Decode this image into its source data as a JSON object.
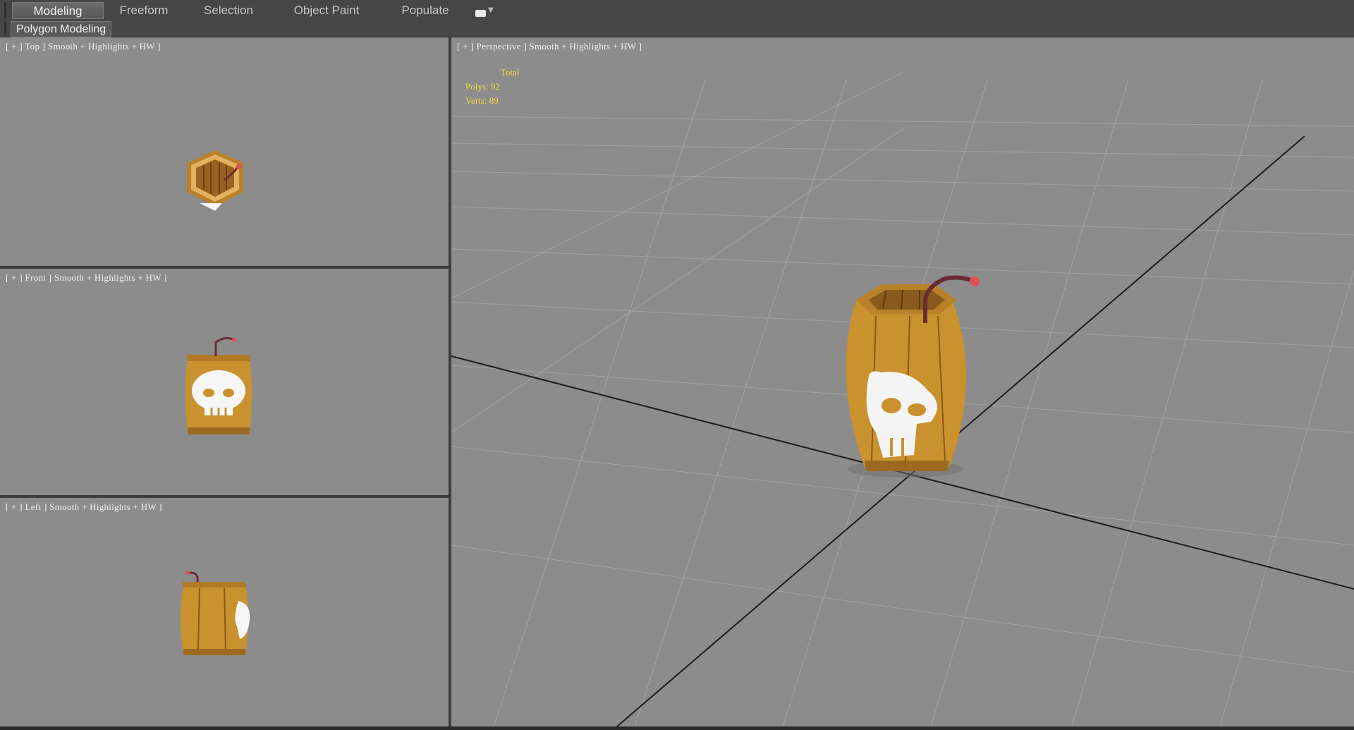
{
  "ribbon": {
    "tabs": [
      {
        "label": "Modeling",
        "active": true
      },
      {
        "label": "Freeform",
        "active": false
      },
      {
        "label": "Selection",
        "active": false
      },
      {
        "label": "Object Paint",
        "active": false
      },
      {
        "label": "Populate",
        "active": false
      }
    ],
    "dropdown_icon": "viewport-camera-icon"
  },
  "subbar": {
    "label": "Polygon Modeling"
  },
  "viewports": {
    "top": {
      "label": "[ + ] Top ] Smooth + Highlights + HW ]"
    },
    "front": {
      "label": "[ + ] Front ] Smooth + Highlights + HW ]"
    },
    "left": {
      "label": "[ + ] Left ] Smooth + Highlights + HW ]"
    },
    "perspective": {
      "label": "[ + ] Perspective ] Smooth + Highlights + HW ]",
      "stats": {
        "header": "Total",
        "polys": "Polys: 92",
        "verts": "Verts: 89"
      }
    }
  },
  "colors": {
    "viewport_bg": "#8c8c8c",
    "stats_text": "#f3dc3c",
    "barrel_wood": "#c9922f",
    "fuse_tip": "#e0505a"
  }
}
